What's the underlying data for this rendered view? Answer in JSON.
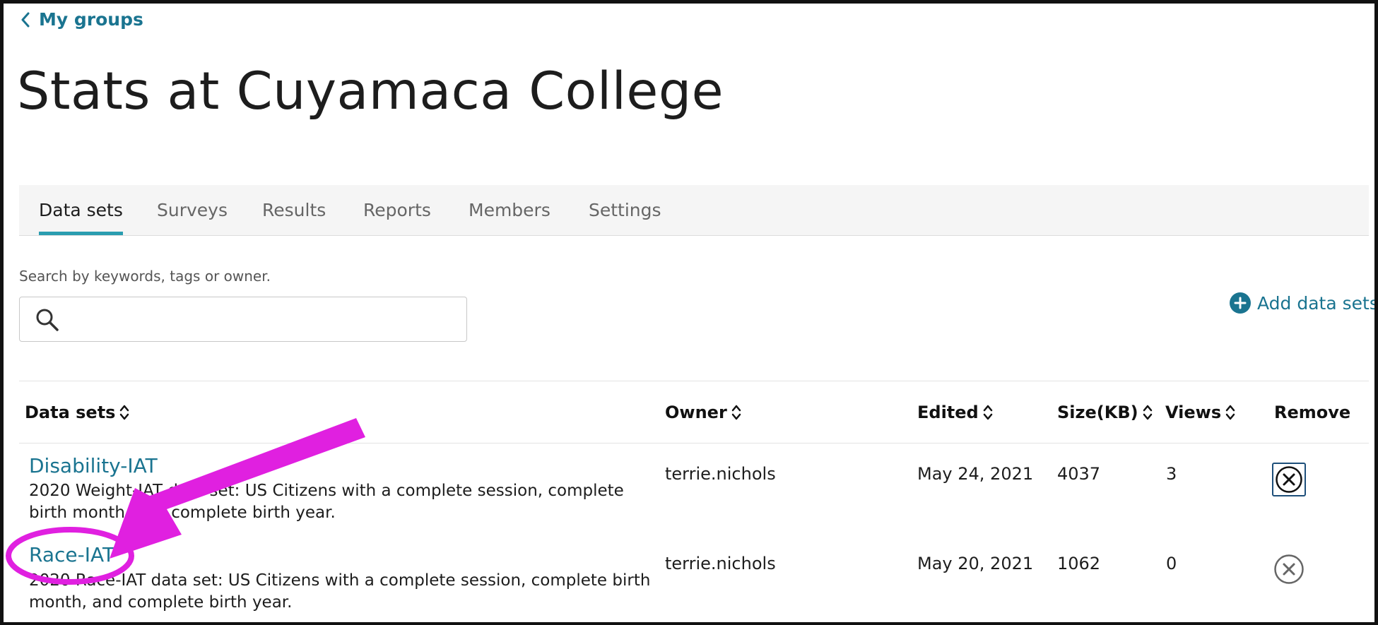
{
  "nav": {
    "back_label": "My groups"
  },
  "page": {
    "title": "Stats at Cuyamaca College"
  },
  "tabs": [
    {
      "label": "Data sets",
      "active": true
    },
    {
      "label": "Surveys",
      "active": false
    },
    {
      "label": "Results",
      "active": false
    },
    {
      "label": "Reports",
      "active": false
    },
    {
      "label": "Members",
      "active": false
    },
    {
      "label": "Settings",
      "active": false
    }
  ],
  "search": {
    "hint": "Search by keywords, tags or owner.",
    "value": "",
    "placeholder": ""
  },
  "actions": {
    "add_label": "Add data sets"
  },
  "table": {
    "headers": {
      "name": "Data sets",
      "owner": "Owner",
      "edited": "Edited",
      "size": "Size(KB)",
      "views": "Views",
      "remove": "Remove"
    },
    "rows": [
      {
        "name": "Disability-IAT",
        "description": "2020 Weight-IAT data set: US Citizens with a complete session, complete birth month, and complete birth year.",
        "owner": "terrie.nichols",
        "edited": "May 24, 2021",
        "size": "4037",
        "views": "3"
      },
      {
        "name": "Race-IAT",
        "description": "2020 Race-IAT data set: US Citizens with a complete session, complete birth month, and complete birth year.",
        "owner": "terrie.nichols",
        "edited": "May 20, 2021",
        "size": "1062",
        "views": "0"
      }
    ]
  },
  "colors": {
    "link": "#1a7490",
    "tab_underline": "#2a9db0",
    "annotation": "#e020e0",
    "focus_border": "#1d4f7a"
  },
  "icons": {
    "back": "chevron-left-icon",
    "search": "magnifier-icon",
    "add": "plus-circle-icon",
    "sort": "sort-up-down-icon",
    "remove": "close-circle-icon"
  }
}
